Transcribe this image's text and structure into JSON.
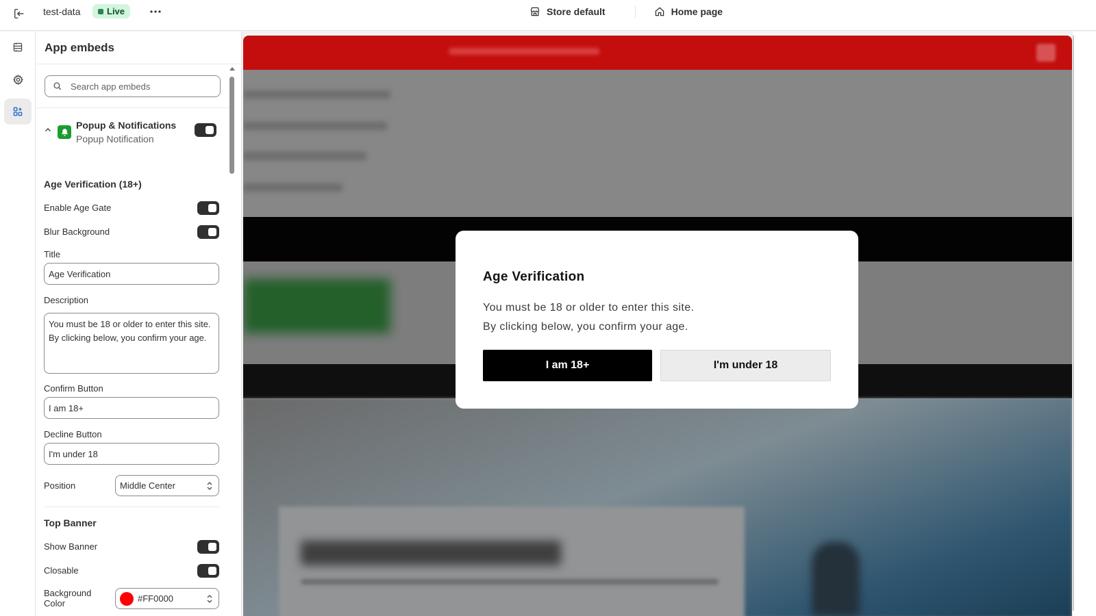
{
  "topbar": {
    "store_name": "test-data",
    "status_badge": "Live",
    "theme_selector": "Store default",
    "page_selector": "Home page"
  },
  "panel": {
    "title": "App embeds",
    "search_placeholder": "Search app embeds",
    "embed": {
      "name": "Popup & Notifications",
      "subtitle": "Popup Notification",
      "enabled": true
    },
    "age_section": {
      "heading": "Age Verification (18+)",
      "enable_age_gate_label": "Enable Age Gate",
      "blur_background_label": "Blur Background",
      "title_label": "Title",
      "title_value": "Age Verification",
      "description_label": "Description",
      "description_value": "You must be 18 or older to enter this site.\nBy clicking below, you confirm your age.",
      "confirm_label": "Confirm Button",
      "confirm_value": "I am 18+",
      "decline_label": "Decline Button",
      "decline_value": "I'm under 18",
      "position_label": "Position",
      "position_value": "Middle Center"
    },
    "banner_section": {
      "heading": "Top Banner",
      "show_banner_label": "Show Banner",
      "closable_label": "Closable",
      "background_color_label": "Background Color",
      "background_color_value": "#FF0000"
    }
  },
  "modal": {
    "title": "Age Verification",
    "description": "You must be 18 or older to enter this site.\nBy clicking below, you confirm your age.",
    "confirm_button": "I am 18+",
    "decline_button": "I'm under 18"
  },
  "colors": {
    "banner_red": "#FF0000",
    "live_badge_bg": "#d3f5dc",
    "toggle_on": "#303030"
  },
  "icons": [
    "exit-icon",
    "more-icon",
    "store-icon",
    "home-icon",
    "sections-icon",
    "gear-icon",
    "app-embeds-icon",
    "search-icon",
    "chevron-up-icon",
    "bell-icon",
    "select-arrows-icon"
  ]
}
